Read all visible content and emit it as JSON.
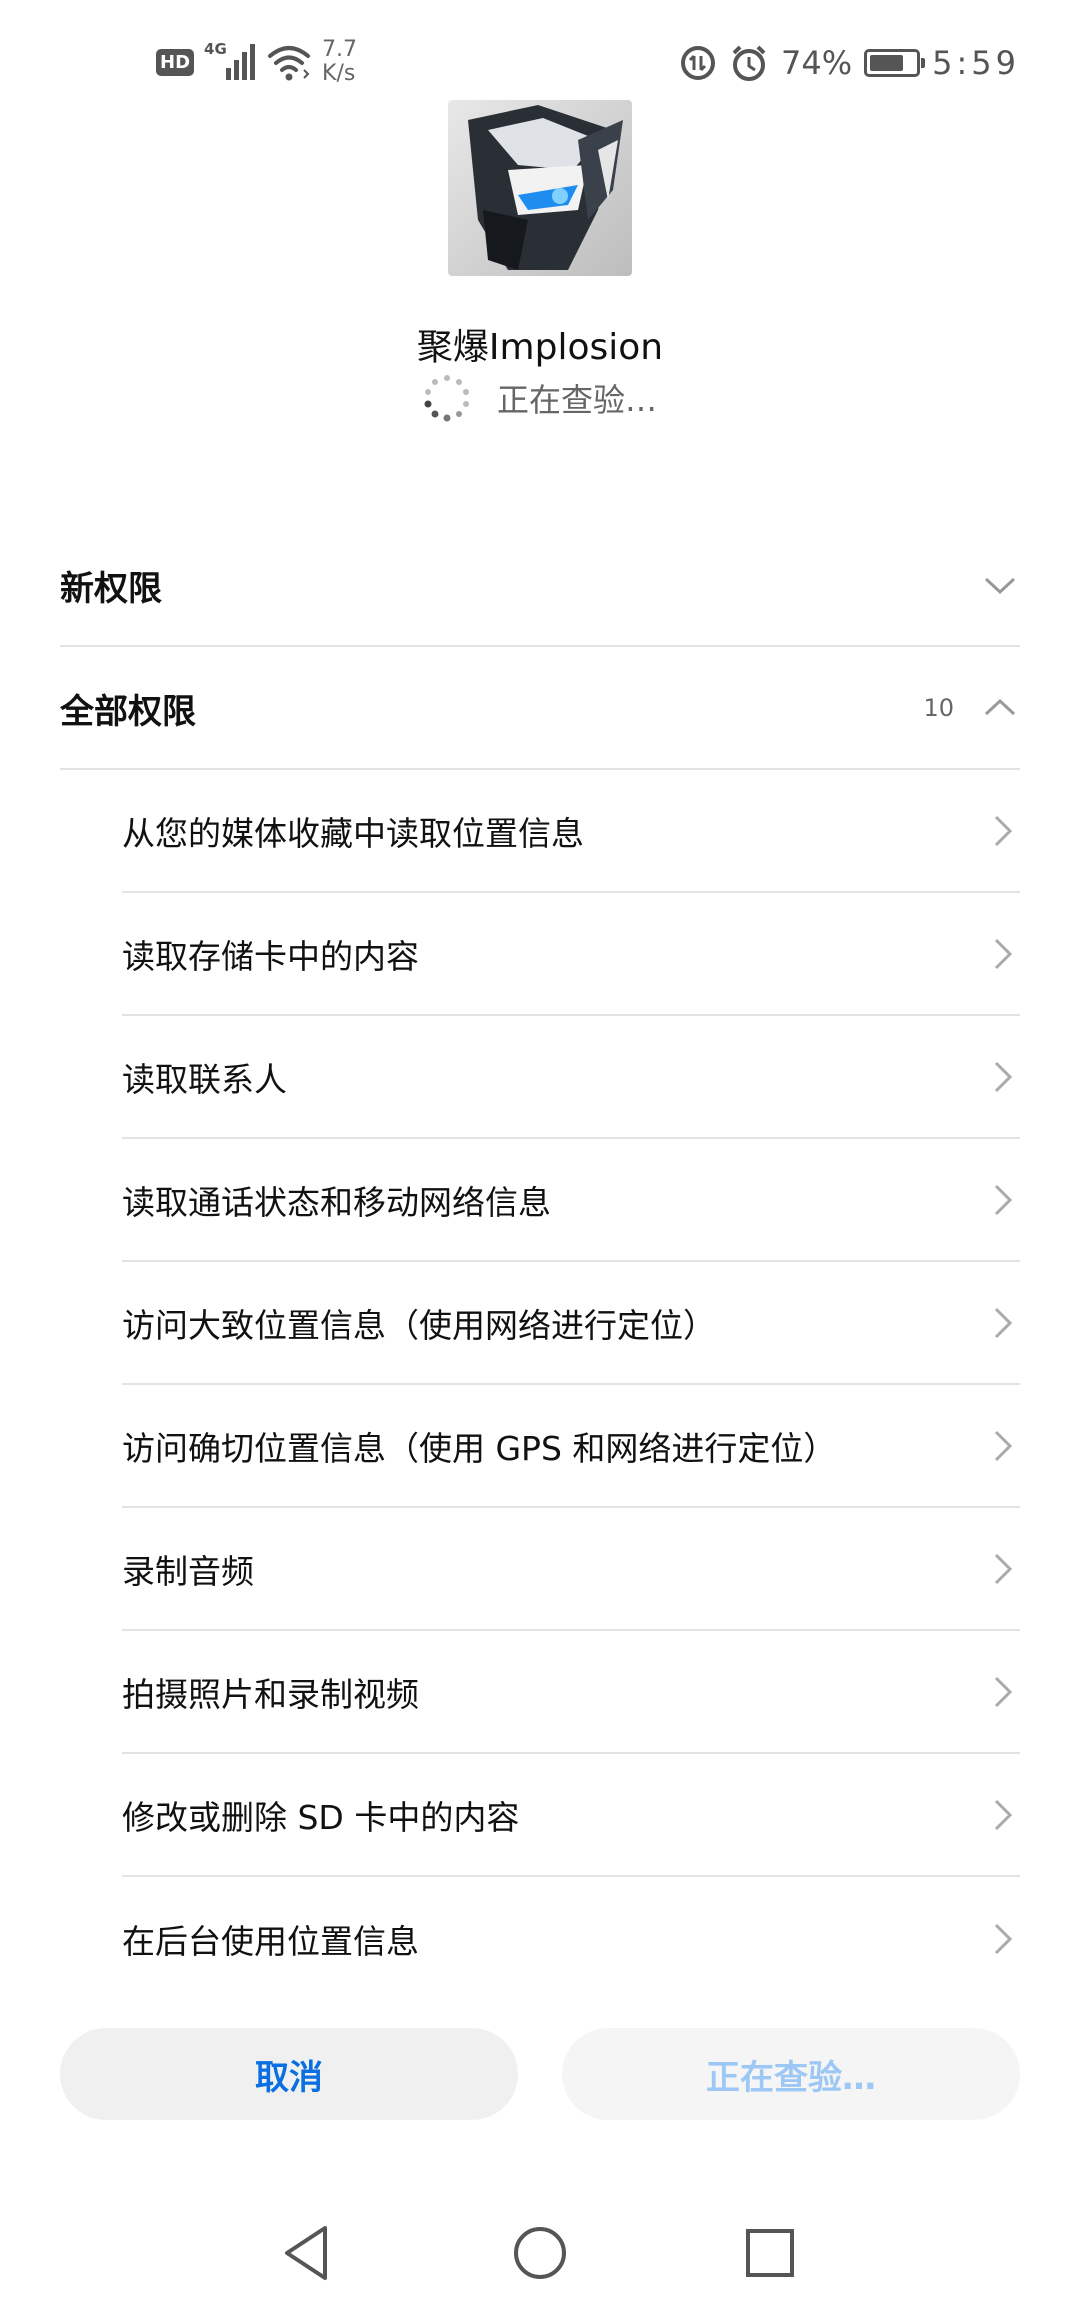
{
  "status_bar": {
    "hd_badge": "HD",
    "network_type": "4G",
    "speed_value": "7.7",
    "speed_unit": "K/s",
    "battery_percent_text": "74%",
    "battery_level": 0.74,
    "time": "5:59"
  },
  "app": {
    "name": "聚爆Implosion",
    "status_text": "正在查验…"
  },
  "sections": {
    "new_permissions": {
      "title": "新权限"
    },
    "all_permissions": {
      "title": "全部权限",
      "count": "10"
    }
  },
  "permissions": [
    "从您的媒体收藏中读取位置信息",
    "读取存储卡中的内容",
    "读取联系人",
    "读取通话状态和移动网络信息",
    "访问大致位置信息（使用网络进行定位）",
    "访问确切位置信息（使用 GPS 和网络进行定位）",
    "录制音频",
    "拍摄照片和录制视频",
    "修改或删除 SD 卡中的内容",
    "在后台使用位置信息"
  ],
  "buttons": {
    "cancel": "取消",
    "checking": "正在查验…"
  },
  "colors": {
    "accent": "#0a6fe0",
    "accent_disabled": "#9dc7f4",
    "divider": "#e3e3e3"
  }
}
